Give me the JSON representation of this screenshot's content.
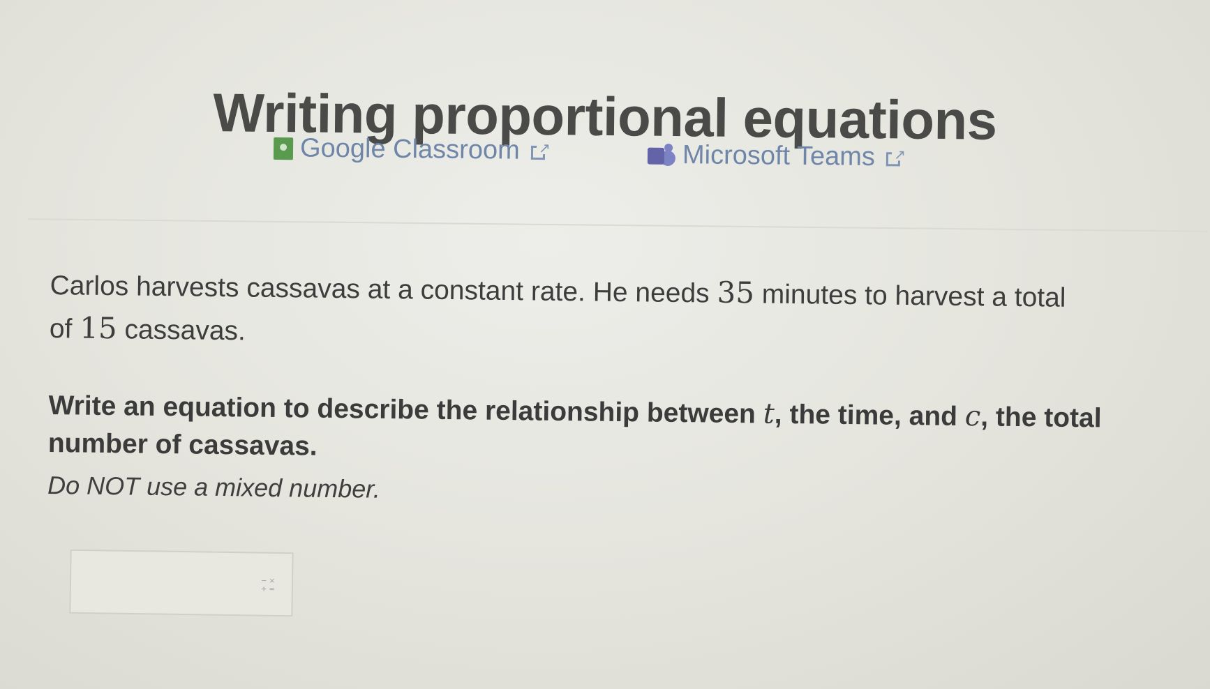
{
  "page": {
    "title": "Writing proportional equations"
  },
  "share": {
    "google_classroom": {
      "label": "Google Classroom",
      "icon": "google-classroom-icon"
    },
    "microsoft_teams": {
      "label": "Microsoft Teams",
      "icon": "microsoft-teams-icon"
    },
    "external_icon": "external-link-icon"
  },
  "problem": {
    "text_1": "Carlos harvests cassavas at a constant rate. He needs ",
    "minutes_value": "35",
    "text_2": " minutes to harvest a total of ",
    "cassavas_value": "15",
    "text_3": " cassavas."
  },
  "question": {
    "text_1": "Write an equation to describe the relationship between ",
    "var_t": "t",
    "text_2": ", the time, and ",
    "var_c": "c",
    "text_3": ", the total number of cassavas.",
    "note": "Do NOT use a mixed number."
  },
  "answer": {
    "value": "",
    "math_icon_top": "− ×",
    "math_icon_bottom": "+ ="
  },
  "colors": {
    "background": "#e4e4dc",
    "title_text": "#4a4a48",
    "link": "#6f86a8",
    "google_classroom_green": "#5a9a4e",
    "teams_purple": "#6264a7"
  }
}
